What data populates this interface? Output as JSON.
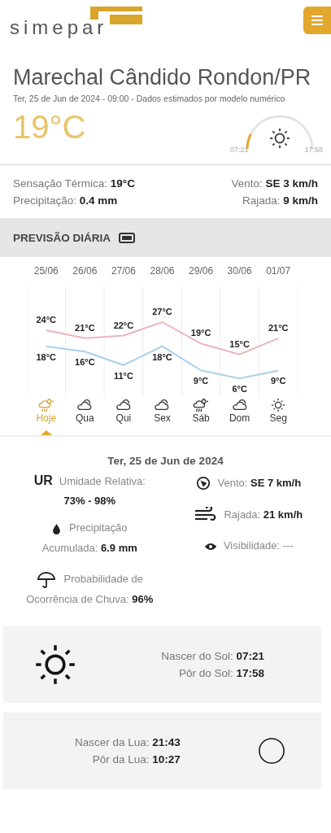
{
  "header": {
    "logo": "simepar"
  },
  "location": {
    "title": "Marechal Cândido Rondon/PR",
    "subtitle": "Ter, 25 de Jun de 2024 - 09:00 - Dados estimados por modelo numérico",
    "temperature": "19°C"
  },
  "sun_arc": {
    "sunrise": "07:21",
    "sunset": "17:58"
  },
  "current": {
    "left": [
      "Sensação Térmica: **19°C**",
      "Precipitação: **0.4 mm**"
    ],
    "right": [
      "Vento: **SE 3 km/h**",
      "Rajada: **9 km/h**"
    ]
  },
  "forecast": {
    "title": "PREVISÃO DIÁRIA",
    "days": [
      {
        "date": "25/06",
        "max": "24°C",
        "min": "18°C",
        "label": "Hoje",
        "kind": "sun-rain",
        "selected": true
      },
      {
        "date": "26/06",
        "max": "21°C",
        "min": "16°C",
        "label": "Qua",
        "kind": "clouds",
        "selected": false
      },
      {
        "date": "27/06",
        "max": "22°C",
        "min": "11°C",
        "label": "Qui",
        "kind": "clouds",
        "selected": false
      },
      {
        "date": "28/06",
        "max": "27°C",
        "min": "18°C",
        "label": "Sex",
        "kind": "clouds",
        "selected": false
      },
      {
        "date": "29/06",
        "max": "19°C",
        "min": "9°C",
        "label": "Sáb",
        "kind": "sun-rain",
        "selected": false
      },
      {
        "date": "30/06",
        "max": "15°C",
        "min": "6°C",
        "label": "Dom",
        "kind": "clouds",
        "selected": false
      },
      {
        "date": "01/07",
        "max": "21°C",
        "min": "9°C",
        "label": "Seg",
        "kind": "sun",
        "selected": false
      }
    ]
  },
  "details": {
    "date": "Ter, 25 de Jun de 2024",
    "left": [
      {
        "kind": "humidity",
        "badge": "UR",
        "label": "Umidade Relativa:",
        "value": "73% - 98%"
      },
      {
        "kind": "drop",
        "text": "Precipitação Acumulada: **6.9 mm**"
      },
      {
        "kind": "umbrella",
        "text": "Probabilidade de Ocorrência de Chuva: **96%**"
      }
    ],
    "right": [
      {
        "kind": "compass",
        "text": "Vento: **SE 7 km/h**"
      },
      {
        "kind": "wind",
        "text": "Rajada: **21 km/h**"
      },
      {
        "kind": "eye",
        "text": "Visibilidade: ---"
      }
    ]
  },
  "sun": {
    "rise": "Nascer do Sol: **07:21**",
    "set": "Pôr do Sol: **17:58**"
  },
  "moon": {
    "rise": "Nascer da Lua: **21:43**",
    "set": "Pôr da Lua: **10:27**"
  }
}
